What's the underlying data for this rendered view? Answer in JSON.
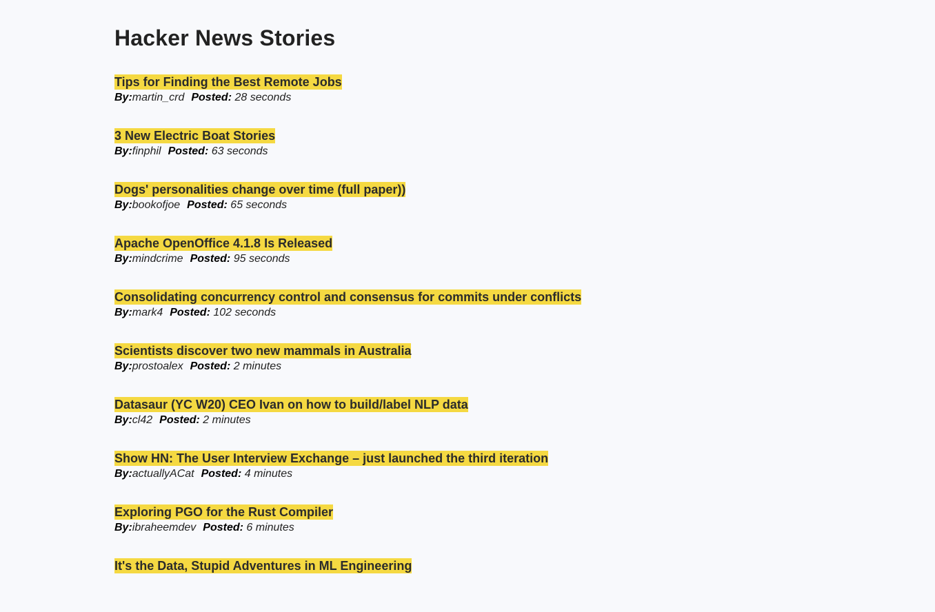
{
  "page": {
    "title": "Hacker News Stories"
  },
  "labels": {
    "by": "By:",
    "posted": "Posted:"
  },
  "stories": [
    {
      "title": "Tips for Finding the Best Remote Jobs",
      "author": "martin_crd",
      "posted": "28 seconds"
    },
    {
      "title": "3 New Electric Boat Stories",
      "author": "finphil",
      "posted": "63 seconds"
    },
    {
      "title": "Dogs' personalities change over time (full paper))",
      "author": "bookofjoe",
      "posted": "65 seconds"
    },
    {
      "title": "Apache OpenOffice 4.1.8 Is Released",
      "author": "mindcrime",
      "posted": "95 seconds"
    },
    {
      "title": "Consolidating concurrency control and consensus for commits under conflicts",
      "author": "mark4",
      "posted": "102 seconds"
    },
    {
      "title": "Scientists discover two new mammals in Australia",
      "author": "prostoalex",
      "posted": "2 minutes"
    },
    {
      "title": "Datasaur (YC W20) CEO Ivan on how to build/label NLP data",
      "author": "cl42",
      "posted": "2 minutes"
    },
    {
      "title": "Show HN: The User Interview Exchange – just launched the third iteration",
      "author": "actuallyACat",
      "posted": "4 minutes"
    },
    {
      "title": "Exploring PGO for the Rust Compiler",
      "author": "ibraheemdev",
      "posted": "6 minutes"
    },
    {
      "title": "It's the Data, Stupid Adventures in ML Engineering",
      "author": "",
      "posted": ""
    }
  ],
  "colors": {
    "highlight": "#f5d942",
    "background": "#f8f9fc"
  }
}
